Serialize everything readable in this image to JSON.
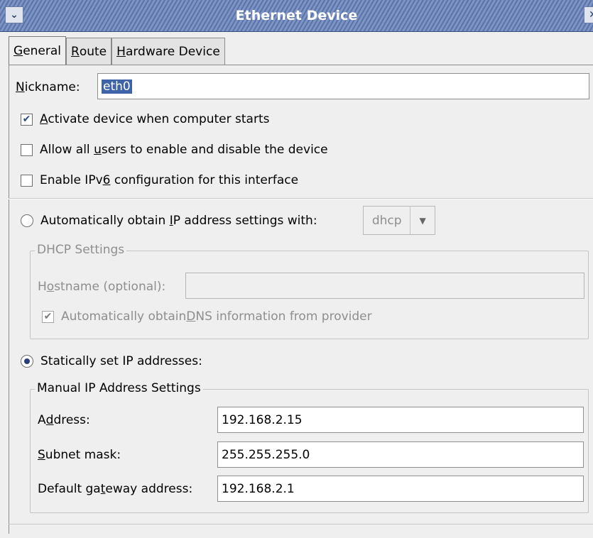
{
  "window": {
    "title": "Ethernet Device",
    "menu_icon": "chevron-down-icon",
    "close_icon": "close-icon"
  },
  "tabs": [
    {
      "label_pre": "",
      "accel": "G",
      "label_post": "eneral",
      "active": true
    },
    {
      "label_pre": "",
      "accel": "R",
      "label_post": "oute",
      "active": false
    },
    {
      "label_pre": "",
      "accel": "H",
      "label_post": "ardware Device",
      "active": false
    }
  ],
  "nickname": {
    "label_accel": "N",
    "label_post": "ickname:",
    "value": "eth0"
  },
  "options": {
    "activate": {
      "pre": "",
      "accel": "A",
      "post": "ctivate device when computer starts",
      "checked": true
    },
    "allow_users": {
      "pre": "Allow all ",
      "accel": "u",
      "post": "sers to enable and disable the device",
      "checked": false
    },
    "ipv6": {
      "pre": "Enable IPv",
      "accel": "6",
      "post": " configuration for this interface",
      "checked": false
    }
  },
  "auto_ip": {
    "pre": "Automatically obtain ",
    "accel": "I",
    "post": "P address settings with:",
    "selected": false,
    "protocol": "dhcp"
  },
  "dhcp": {
    "group_title": "DHCP Settings",
    "hostname_pre": "H",
    "hostname_accel": "o",
    "hostname_post": "stname (optional):",
    "hostname_value": "",
    "dns_pre": "Automatically obtain ",
    "dns_accel": "D",
    "dns_post": "NS information from provider",
    "dns_checked": true
  },
  "static_ip": {
    "label": "Statically set IP addresses:",
    "selected": true
  },
  "manual": {
    "group_title": "Manual IP Address Settings",
    "address_pre": "A",
    "address_accel": "d",
    "address_post": "dress:",
    "address_value": "192.168.2.15",
    "subnet_pre": "",
    "subnet_accel": "S",
    "subnet_post": "ubnet mask:",
    "subnet_value": "255.255.255.0",
    "gateway_pre": "Default ga",
    "gateway_accel": "t",
    "gateway_post": "eway address:",
    "gateway_value": "192.168.2.1"
  },
  "colors": {
    "selection": "#3e63a8",
    "titlebar": "#5a73a8"
  }
}
